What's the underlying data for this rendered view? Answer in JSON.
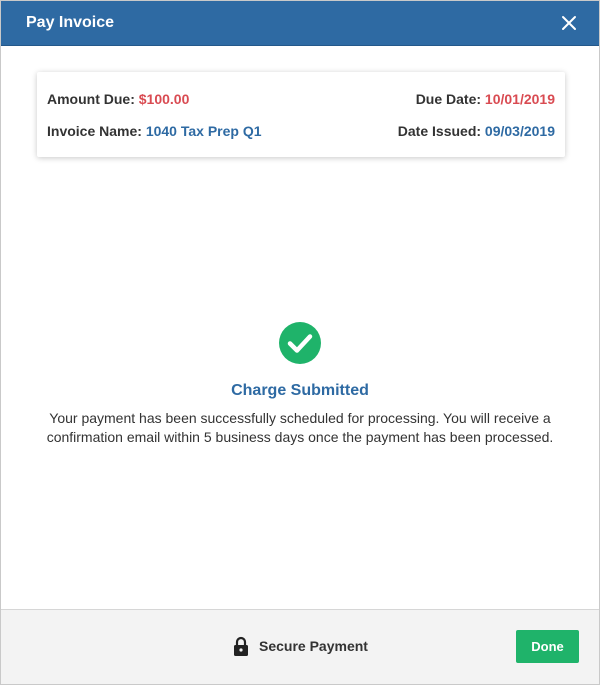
{
  "header": {
    "title": "Pay Invoice",
    "close_icon": "close-icon"
  },
  "invoice_summary": {
    "amount_due_label": "Amount Due:",
    "amount_due_value": "$100.00",
    "due_date_label": "Due Date:",
    "due_date_value": "10/01/2019",
    "invoice_name_label": "Invoice Name:",
    "invoice_name_value": "1040 Tax Prep Q1",
    "date_issued_label": "Date Issued:",
    "date_issued_value": "09/03/2019"
  },
  "status": {
    "icon": "check-circle-icon",
    "title": "Charge Submitted",
    "message": "Your payment has been successfully scheduled for processing. You will receive a confirmation email within 5 business days once the payment has been processed."
  },
  "footer": {
    "secure_icon": "lock-icon",
    "secure_label": "Secure Payment",
    "done_label": "Done"
  },
  "colors": {
    "header_bg": "#2e6aa3",
    "accent_blue": "#2e6aa3",
    "accent_red": "#d94b52",
    "success_green": "#1fb36a"
  }
}
